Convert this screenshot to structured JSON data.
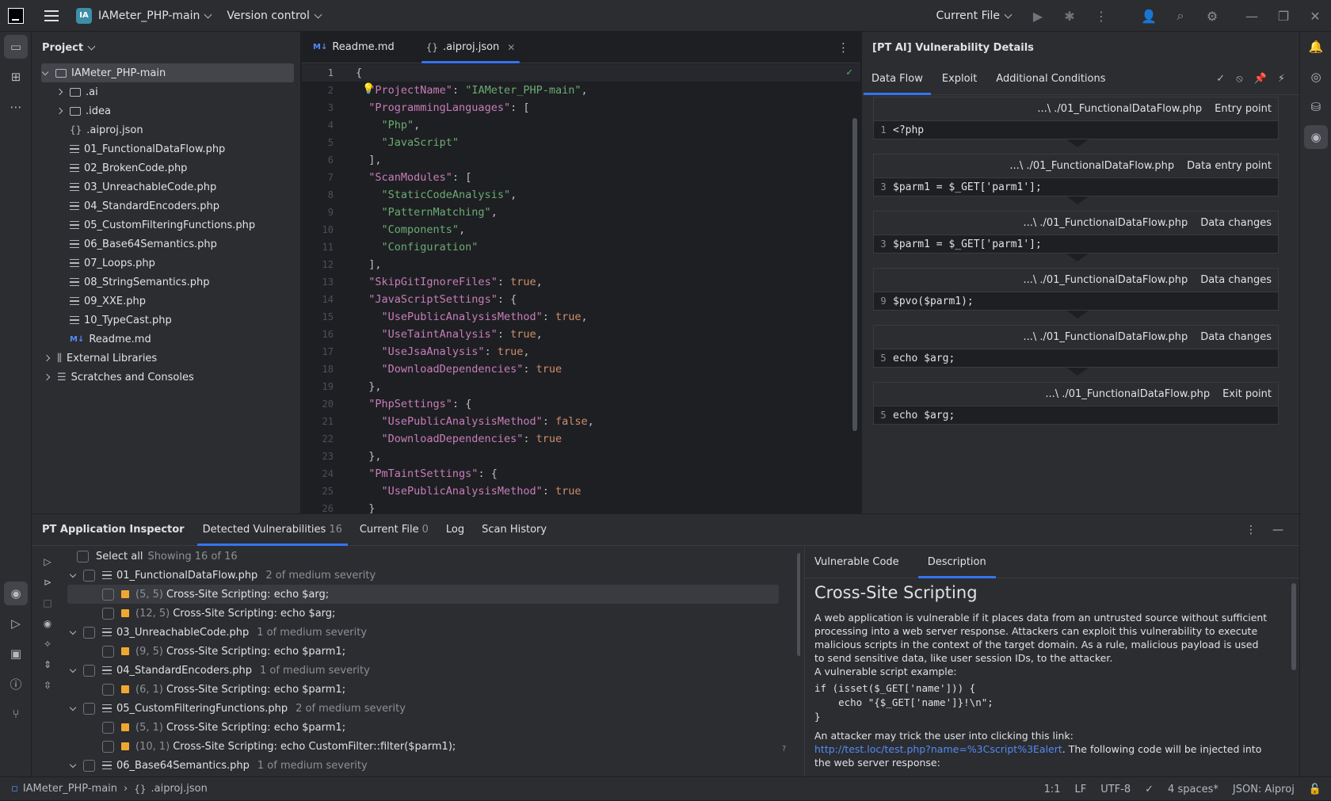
{
  "titlebar": {
    "project_badge": "IA",
    "project_name": "IAMeter_PHP-main",
    "vcs": "Version control",
    "run_config": "Current File"
  },
  "project_panel": {
    "title": "Project",
    "root": "IAMeter_PHP-main",
    "items": [
      {
        "label": ".ai",
        "kind": "folder"
      },
      {
        "label": ".idea",
        "kind": "folder"
      },
      {
        "label": ".aiproj.json",
        "kind": "json"
      },
      {
        "label": "01_FunctionalDataFlow.php",
        "kind": "php"
      },
      {
        "label": "02_BrokenCode.php",
        "kind": "php"
      },
      {
        "label": "03_UnreachableCode.php",
        "kind": "php"
      },
      {
        "label": "04_StandardEncoders.php",
        "kind": "php"
      },
      {
        "label": "05_CustomFilteringFunctions.php",
        "kind": "php"
      },
      {
        "label": "06_Base64Semantics.php",
        "kind": "php"
      },
      {
        "label": "07_Loops.php",
        "kind": "php"
      },
      {
        "label": "08_StringSemantics.php",
        "kind": "php"
      },
      {
        "label": "09_XXE.php",
        "kind": "php"
      },
      {
        "label": "10_TypeCast.php",
        "kind": "php"
      },
      {
        "label": "Readme.md",
        "kind": "md"
      }
    ],
    "external": "External Libraries",
    "scratches": "Scratches and Consoles"
  },
  "editor": {
    "tabs": [
      {
        "label": "Readme.md",
        "icon": "M↓"
      },
      {
        "label": ".aiproj.json",
        "icon": "{}"
      }
    ],
    "lines": [
      [
        [
          "p",
          "{"
        ]
      ],
      [
        [
          "p",
          "  "
        ],
        [
          "k",
          "\"ProjectName\""
        ],
        [
          "p",
          ": "
        ],
        [
          "s",
          "\"IAMeter_PHP-main\""
        ],
        [
          "p",
          ","
        ]
      ],
      [
        [
          "p",
          "  "
        ],
        [
          "k",
          "\"ProgrammingLanguages\""
        ],
        [
          "p",
          ": ["
        ]
      ],
      [
        [
          "p",
          "    "
        ],
        [
          "s",
          "\"Php\""
        ],
        [
          "p",
          ","
        ]
      ],
      [
        [
          "p",
          "    "
        ],
        [
          "s",
          "\"JavaScript\""
        ]
      ],
      [
        [
          "p",
          "  ],"
        ]
      ],
      [
        [
          "p",
          "  "
        ],
        [
          "k",
          "\"ScanModules\""
        ],
        [
          "p",
          ": ["
        ]
      ],
      [
        [
          "p",
          "    "
        ],
        [
          "s",
          "\"StaticCodeAnalysis\""
        ],
        [
          "p",
          ","
        ]
      ],
      [
        [
          "p",
          "    "
        ],
        [
          "s",
          "\"PatternMatching\""
        ],
        [
          "p",
          ","
        ]
      ],
      [
        [
          "p",
          "    "
        ],
        [
          "s",
          "\"Components\""
        ],
        [
          "p",
          ","
        ]
      ],
      [
        [
          "p",
          "    "
        ],
        [
          "s",
          "\"Configuration\""
        ]
      ],
      [
        [
          "p",
          "  ],"
        ]
      ],
      [
        [
          "p",
          "  "
        ],
        [
          "k",
          "\"SkipGitIgnoreFiles\""
        ],
        [
          "p",
          ": "
        ],
        [
          "b",
          "true"
        ],
        [
          "p",
          ","
        ]
      ],
      [
        [
          "p",
          "  "
        ],
        [
          "k",
          "\"JavaScriptSettings\""
        ],
        [
          "p",
          ": {"
        ]
      ],
      [
        [
          "p",
          "    "
        ],
        [
          "k",
          "\"UsePublicAnalysisMethod\""
        ],
        [
          "p",
          ": "
        ],
        [
          "b",
          "true"
        ],
        [
          "p",
          ","
        ]
      ],
      [
        [
          "p",
          "    "
        ],
        [
          "k",
          "\"UseTaintAnalysis\""
        ],
        [
          "p",
          ": "
        ],
        [
          "b",
          "true"
        ],
        [
          "p",
          ","
        ]
      ],
      [
        [
          "p",
          "    "
        ],
        [
          "k",
          "\"UseJsaAnalysis\""
        ],
        [
          "p",
          ": "
        ],
        [
          "b",
          "true"
        ],
        [
          "p",
          ","
        ]
      ],
      [
        [
          "p",
          "    "
        ],
        [
          "k",
          "\"DownloadDependencies\""
        ],
        [
          "p",
          ": "
        ],
        [
          "b",
          "true"
        ]
      ],
      [
        [
          "p",
          "  },"
        ]
      ],
      [
        [
          "p",
          "  "
        ],
        [
          "k",
          "\"PhpSettings\""
        ],
        [
          "p",
          ": {"
        ]
      ],
      [
        [
          "p",
          "    "
        ],
        [
          "k",
          "\"UsePublicAnalysisMethod\""
        ],
        [
          "p",
          ": "
        ],
        [
          "b",
          "false"
        ],
        [
          "p",
          ","
        ]
      ],
      [
        [
          "p",
          "    "
        ],
        [
          "k",
          "\"DownloadDependencies\""
        ],
        [
          "p",
          ": "
        ],
        [
          "b",
          "true"
        ]
      ],
      [
        [
          "p",
          "  },"
        ]
      ],
      [
        [
          "p",
          "  "
        ],
        [
          "k",
          "\"PmTaintSettings\""
        ],
        [
          "p",
          ": {"
        ]
      ],
      [
        [
          "p",
          "    "
        ],
        [
          "k",
          "\"UsePublicAnalysisMethod\""
        ],
        [
          "p",
          ": "
        ],
        [
          "b",
          "true"
        ]
      ],
      [
        [
          "p",
          "  }"
        ]
      ]
    ]
  },
  "vuln_details": {
    "title": "[PT AI] Vulnerability Details",
    "tabs": [
      "Data Flow",
      "Exploit",
      "Additional Conditions"
    ],
    "flow": [
      {
        "path": "...\\ ./01_FunctionalDataFlow.php",
        "kind": "Entry point",
        "line": "1",
        "code": "<?php"
      },
      {
        "path": "...\\ ./01_FunctionalDataFlow.php",
        "kind": "Data entry point",
        "line": "3",
        "code": "$parm1 = $_GET['parm1'];"
      },
      {
        "path": "...\\ ./01_FunctionalDataFlow.php",
        "kind": "Data changes",
        "line": "3",
        "code": "$parm1 = $_GET['parm1'];"
      },
      {
        "path": "...\\ ./01_FunctionalDataFlow.php",
        "kind": "Data changes",
        "line": "9",
        "code": "$pvo($parm1);"
      },
      {
        "path": "...\\ ./01_FunctionalDataFlow.php",
        "kind": "Data changes",
        "line": "5",
        "code": "echo $arg;"
      },
      {
        "path": "...\\ ./01_FunctionalDataFlow.php",
        "kind": "Exit point",
        "line": "5",
        "code": "echo $arg;"
      }
    ]
  },
  "inspector": {
    "title": "PT Application Inspector",
    "tabs": [
      {
        "label": "Detected Vulnerabilities",
        "count": "16"
      },
      {
        "label": "Current File",
        "count": "0"
      },
      {
        "label": "Log",
        "count": ""
      },
      {
        "label": "Scan History",
        "count": ""
      }
    ],
    "select_all": "Select all",
    "showing": "Showing 16 of 16",
    "rows": [
      {
        "type": "file",
        "label": "01_FunctionalDataFlow.php",
        "meta": "2 of medium severity"
      },
      {
        "type": "issue",
        "loc": "(5, 5)",
        "label": "Cross-Site Scripting: echo $arg;",
        "selected": true
      },
      {
        "type": "issue",
        "loc": "(12, 5)",
        "label": "Cross-Site Scripting: echo $arg;"
      },
      {
        "type": "file",
        "label": "03_UnreachableCode.php",
        "meta": "1 of medium severity"
      },
      {
        "type": "issue",
        "loc": "(9, 5)",
        "label": "Cross-Site Scripting: echo $parm1;"
      },
      {
        "type": "file",
        "label": "04_StandardEncoders.php",
        "meta": "1 of medium severity"
      },
      {
        "type": "issue",
        "loc": "(6, 1)",
        "label": "Cross-Site Scripting: echo $parm1;"
      },
      {
        "type": "file",
        "label": "05_CustomFilteringFunctions.php",
        "meta": "2 of medium severity"
      },
      {
        "type": "issue",
        "loc": "(5, 1)",
        "label": "Cross-Site Scripting: echo $parm1;"
      },
      {
        "type": "issue",
        "loc": "(10, 1)",
        "label": "Cross-Site Scripting: echo CustomFilter::filter($parm1);"
      },
      {
        "type": "file",
        "label": "06_Base64Semantics.php",
        "meta": "1 of medium severity"
      }
    ],
    "desc_tabs": [
      "Vulnerable Code",
      "Description"
    ],
    "desc": {
      "heading": "Cross-Site Scripting",
      "para1": "A web application is vulnerable if it places data from an untrusted source without sufficient processing into a web server response. Attackers can exploit this vulnerability to execute malicious scripts in the context of the target domain. As a rule, malicious payload is used to send sensitive data, like user session IDs, to the attacker.",
      "para2": "A vulnerable script example:",
      "code": "if (isset($_GET['name'])) {\n    echo \"{$_GET['name']}!\\n\";\n}",
      "para3": "An attacker may trick the user into clicking this link:",
      "link": "http://test.loc/test.php?name=%3Cscript%3Ealert",
      "para4": ". The following code will be injected into the web server response:"
    }
  },
  "status": {
    "crumb_project": "IAMeter_PHP-main",
    "crumb_file": ".aiproj.json",
    "position": "1:1",
    "line_sep": "LF",
    "encoding": "UTF-8",
    "indent": "4 spaces*",
    "schema": "JSON: Aiproj"
  },
  "colors": {
    "accent": "#3574f0",
    "severity_medium": "#f0a732",
    "bg": "#1e1f22",
    "panel": "#2b2d30"
  }
}
